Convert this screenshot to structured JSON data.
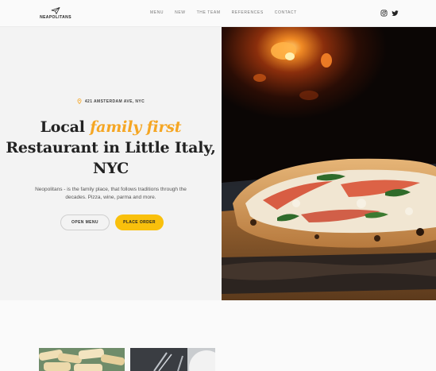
{
  "brand": {
    "name": "NEAPOLITANS",
    "icon": "paper-plane-icon"
  },
  "nav": [
    {
      "label": "MENU"
    },
    {
      "label": "NEW"
    },
    {
      "label": "THE TEAM"
    },
    {
      "label": "REFERENCES"
    },
    {
      "label": "CONTACT"
    }
  ],
  "social": {
    "instagram": "instagram-icon",
    "twitter": "twitter-icon"
  },
  "hero": {
    "address": "421 AMSTERDAM AVE, NYC",
    "headline_pre": "Local ",
    "headline_accent": "family first",
    "headline_post": "Restaurant in Little Italy, NYC",
    "description": "Neopolitans - is the family place, that follows traditions through the decades. Pizza, wine, parma and more.",
    "open_menu_label": "OPEN MENU",
    "place_order_label": "PLACE ORDER"
  },
  "colors": {
    "accent": "#f5a623",
    "button_yellow": "#f9c00c",
    "text_dark": "#222222"
  }
}
